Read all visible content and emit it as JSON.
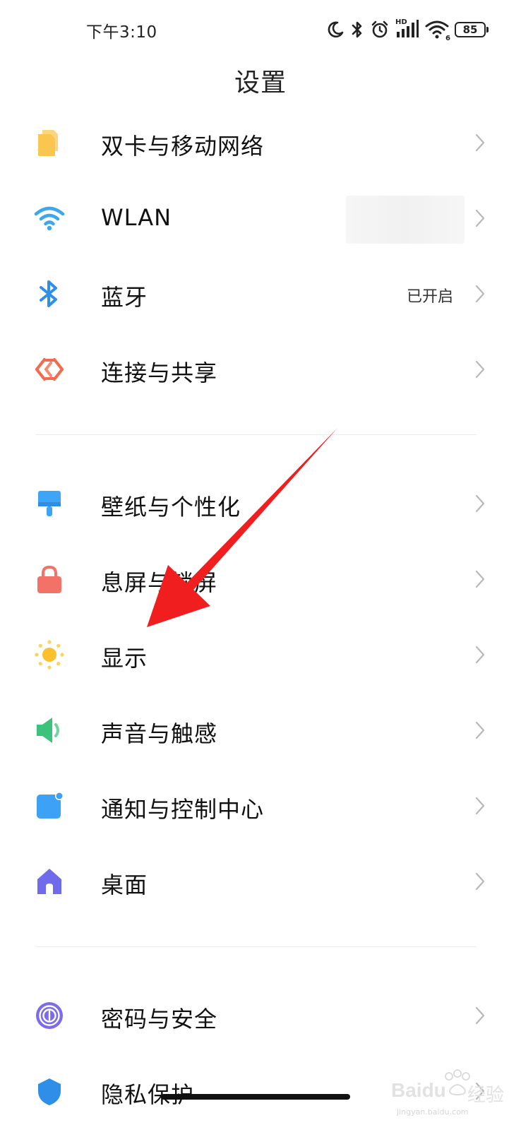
{
  "status_bar": {
    "time": "下午3:10",
    "hd_label": "HD",
    "wifi_label": "6",
    "battery": "85"
  },
  "title": "设置",
  "groups": [
    {
      "items": [
        {
          "label": "双卡与移动网络",
          "icon": "sim-card-icon",
          "color": "#F9C74F"
        },
        {
          "label": "WLAN",
          "icon": "wifi-icon",
          "color": "#3BA7F0"
        },
        {
          "label": "蓝牙",
          "icon": "bluetooth-icon",
          "color": "#2F8FE8",
          "status": "已开启"
        },
        {
          "label": "连接与共享",
          "icon": "share-icon",
          "color": "#F26B4F"
        }
      ]
    },
    {
      "items": [
        {
          "label": "壁纸与个性化",
          "icon": "brush-icon",
          "color": "#3EA4F6"
        },
        {
          "label": "息屏与锁屏",
          "icon": "lock-icon",
          "color": "#F37267"
        },
        {
          "label": "显示",
          "icon": "sun-icon",
          "color": "#FBC02D"
        },
        {
          "label": "声音与触感",
          "icon": "speaker-icon",
          "color": "#3CC27A"
        },
        {
          "label": "通知与控制中心",
          "icon": "notification-icon",
          "color": "#3DA2F5"
        },
        {
          "label": "桌面",
          "icon": "home-icon",
          "color": "#6F6BEA"
        }
      ]
    },
    {
      "items": [
        {
          "label": "密码与安全",
          "icon": "fingerprint-icon",
          "color": "#7C6CEB"
        },
        {
          "label": "隐私保护",
          "icon": "privacy-icon",
          "color": "#2F8FE8"
        }
      ]
    }
  ],
  "watermark": {
    "brand": "Baidu",
    "cn": "经验",
    "url": "jingyan.baidu.com"
  },
  "annotation": {
    "arrow_color": "#F01E1E"
  }
}
